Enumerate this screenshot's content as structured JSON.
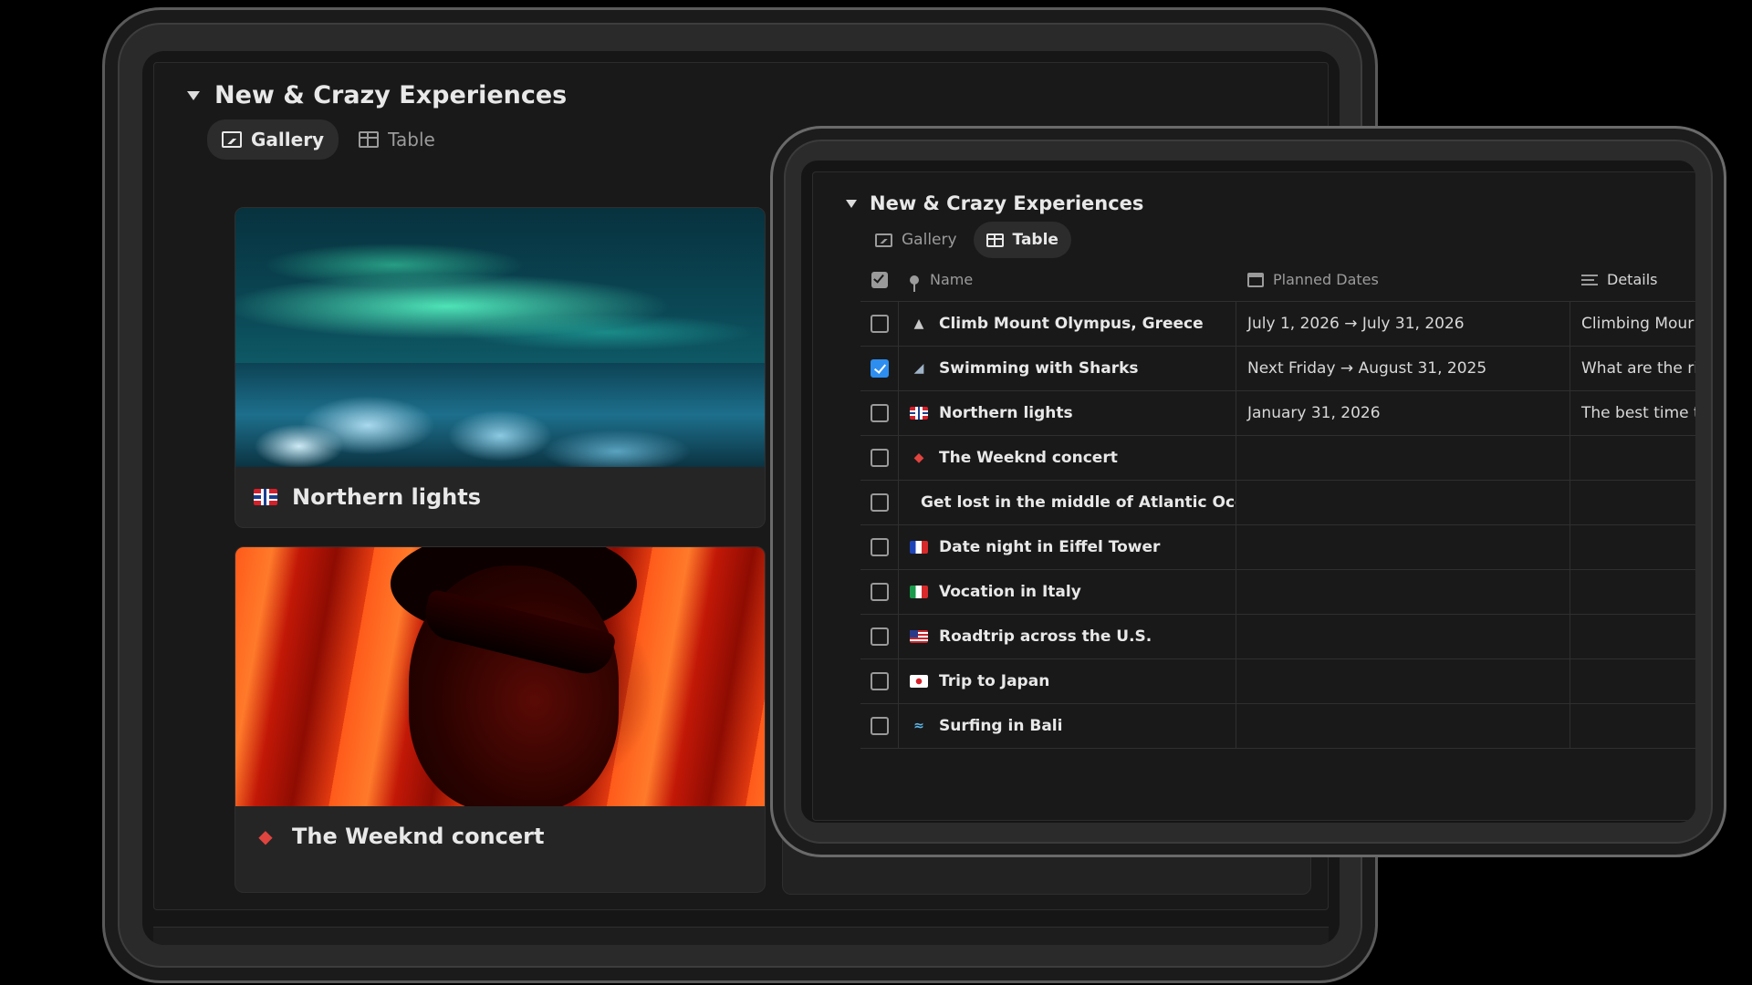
{
  "section": {
    "title": "New & Crazy Experiences"
  },
  "back_device": {
    "tabs": [
      {
        "label": "Gallery",
        "icon": "image-icon",
        "active": true
      },
      {
        "label": "Table",
        "icon": "table-icon",
        "active": false
      }
    ],
    "cards": [
      {
        "title": "Northern lights",
        "icon": "norway-flag-icon"
      },
      {
        "title": "The Weeknd concert",
        "icon": "ticket-icon"
      }
    ]
  },
  "front_device": {
    "tabs": [
      {
        "label": "Gallery",
        "icon": "image-icon",
        "active": false
      },
      {
        "label": "Table",
        "icon": "table-icon",
        "active": true
      }
    ],
    "columns": {
      "name": "Name",
      "dates": "Planned Dates",
      "details": "Details"
    },
    "rows": [
      {
        "name": "Climb Mount Olympus, Greece",
        "icon": "mountain-icon",
        "checked": false,
        "dates": "July 1, 2026 → July 31, 2026",
        "details": "Climbing Mour"
      },
      {
        "name": "Swimming with Sharks",
        "icon": "shark-icon",
        "checked": true,
        "dates": "Next Friday → August 31, 2025",
        "details": "What are the ri"
      },
      {
        "name": "Northern lights",
        "icon": "norway-flag-icon",
        "checked": false,
        "dates": "January 31, 2026",
        "details": "The best time t"
      },
      {
        "name": "The Weeknd concert",
        "icon": "ticket-icon",
        "checked": false,
        "dates": "",
        "details": ""
      },
      {
        "name": "Get lost in the middle of Atlantic Ocean",
        "icon": "globe-icon",
        "checked": false,
        "dates": "",
        "details": ""
      },
      {
        "name": "Date night in Eiffel Tower",
        "icon": "france-flag-icon",
        "checked": false,
        "dates": "",
        "details": ""
      },
      {
        "name": "Vocation in Italy",
        "icon": "italy-flag-icon",
        "checked": false,
        "dates": "",
        "details": ""
      },
      {
        "name": "Roadtrip across the U.S.",
        "icon": "us-flag-icon",
        "checked": false,
        "dates": "",
        "details": ""
      },
      {
        "name": "Trip to Japan",
        "icon": "japan-flag-icon",
        "checked": false,
        "dates": "",
        "details": ""
      },
      {
        "name": "Surfing in Bali",
        "icon": "surfer-icon",
        "checked": false,
        "dates": "",
        "details": ""
      }
    ]
  },
  "colors": {
    "background": "#000000",
    "panel": "#191919",
    "accent_checkbox": "#2d8ef0"
  }
}
